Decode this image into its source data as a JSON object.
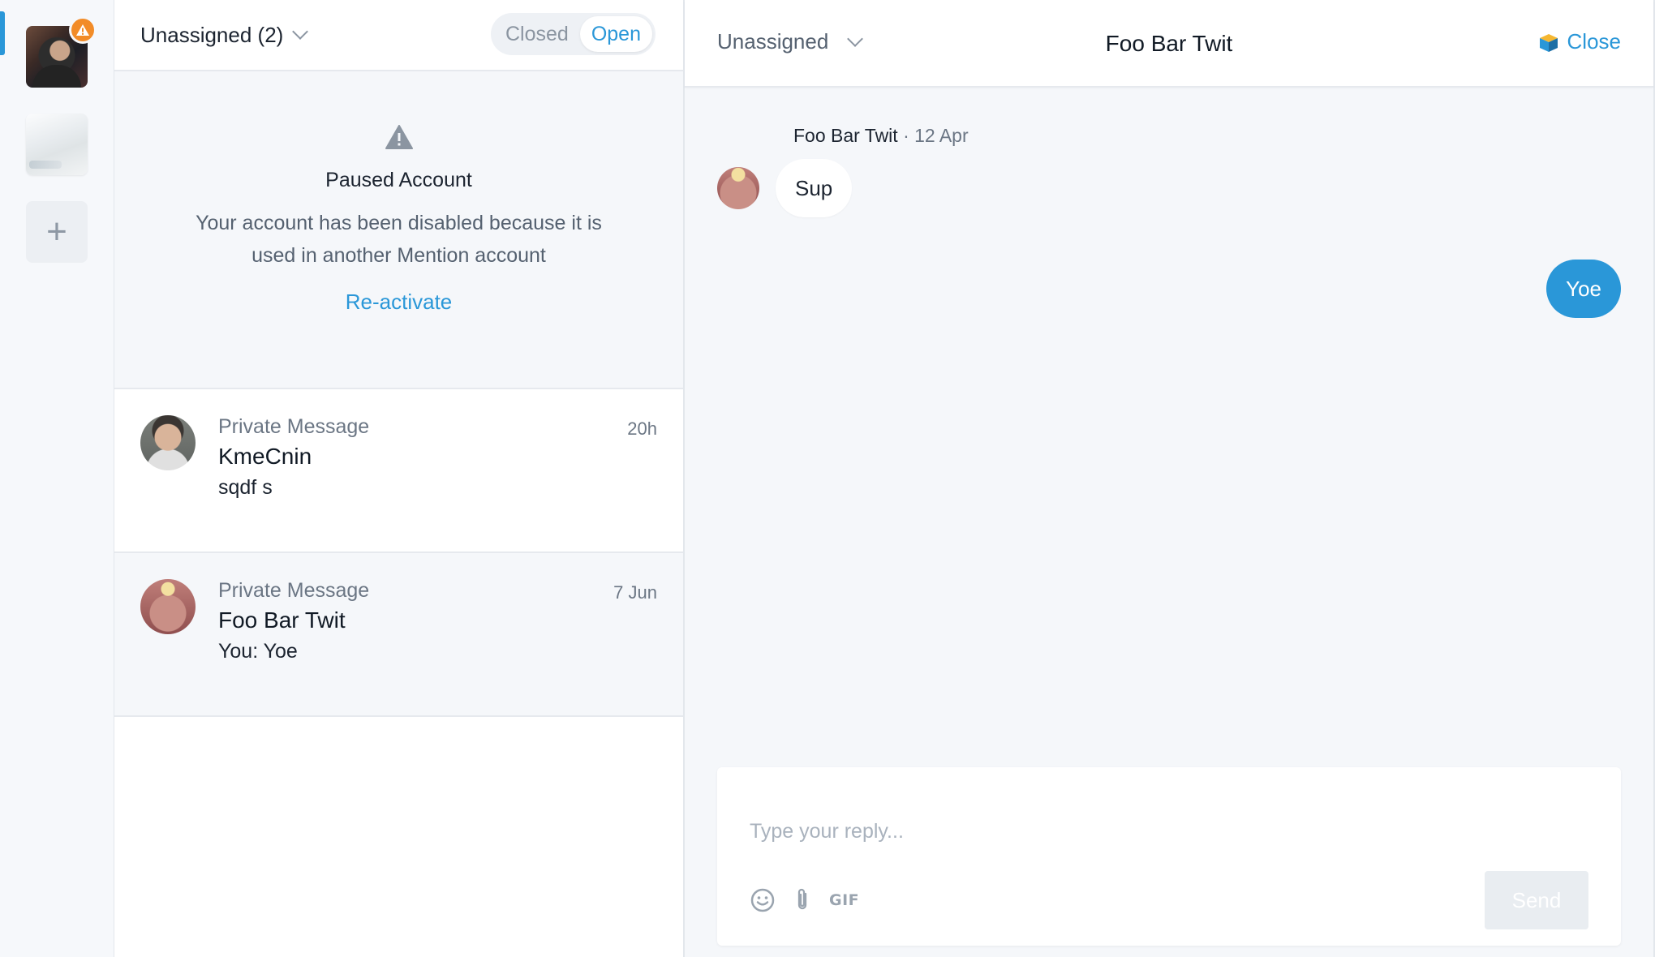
{
  "rail": {
    "accounts": [
      {
        "name": "account-1",
        "warning": true
      },
      {
        "name": "account-2",
        "warning": false
      }
    ],
    "add_label": "+"
  },
  "inbox": {
    "filter_label": "Unassigned (2)",
    "toggle": {
      "closed": "Closed",
      "open": "Open",
      "selected": "Open"
    },
    "paused": {
      "title": "Paused Account",
      "text": "Your account has been disabled because it is used in another Mention account",
      "action": "Re-activate"
    },
    "conversations": [
      {
        "type": "Private Message",
        "name": "KmeCnin",
        "preview": "sqdf s",
        "time": "20h",
        "avatar": "man-avatar",
        "selected": false
      },
      {
        "type": "Private Message",
        "name": "Foo Bar Twit",
        "preview": "You: Yoe",
        "time": "7 Jun",
        "avatar": "cat-avatar",
        "selected": true
      }
    ]
  },
  "chat": {
    "assignee": "Unassigned",
    "title": "Foo Bar Twit",
    "close_label": "Close",
    "messages": [
      {
        "direction": "in",
        "author": "Foo Bar Twit",
        "separator": "·",
        "date": "12 Apr",
        "text": "Sup"
      },
      {
        "direction": "out",
        "text": "Yoe"
      }
    ],
    "composer": {
      "placeholder": "Type your reply...",
      "gif_label": "GIF",
      "send_label": "Send"
    }
  },
  "colors": {
    "accent": "#2a97d8",
    "warning": "#f28c28",
    "background": "#f5f7fa"
  }
}
